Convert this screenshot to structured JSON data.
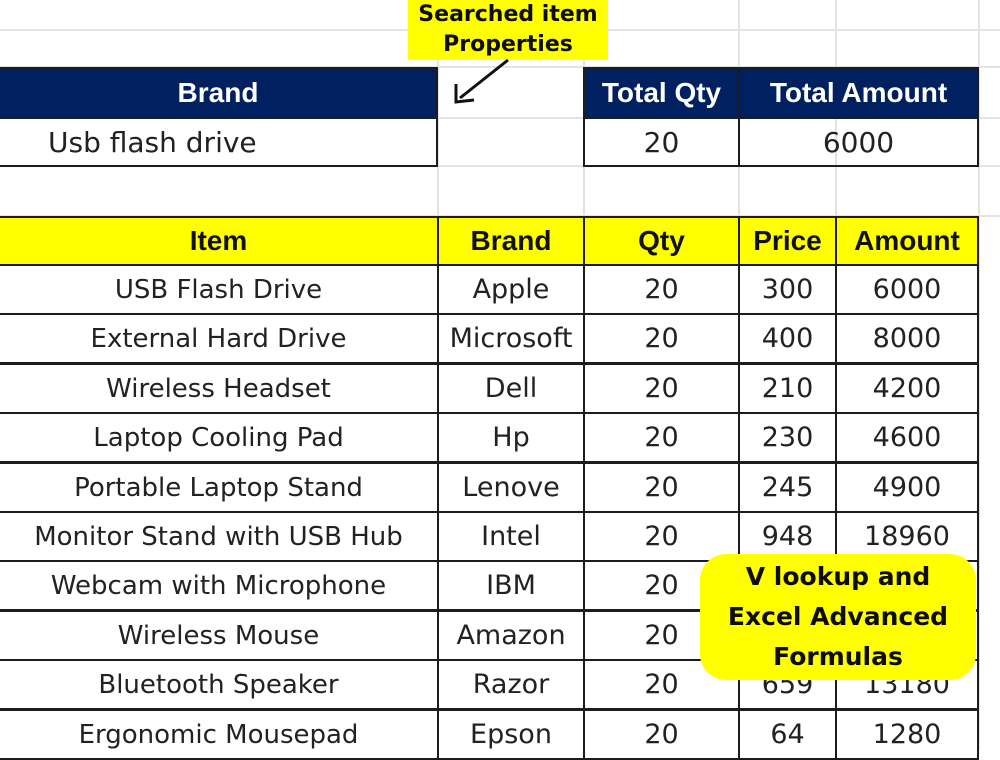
{
  "annotation_top": {
    "line1": "Searched item",
    "line2": "Properties"
  },
  "lookup": {
    "brand_header": "Brand",
    "brand_value": "Usb flash drive",
    "total_qty_header": "Total Qty",
    "total_qty_value": "20",
    "total_amount_header": "Total Amount",
    "total_amount_value": "6000"
  },
  "table": {
    "headers": {
      "item": "Item",
      "brand": "Brand",
      "qty": "Qty",
      "price": "Price",
      "amount": "Amount"
    },
    "rows": [
      {
        "item": "USB Flash Drive",
        "brand": "Apple",
        "qty": "20",
        "price": "300",
        "amount": "6000"
      },
      {
        "item": "External Hard Drive",
        "brand": "Microsoft",
        "qty": "20",
        "price": "400",
        "amount": "8000"
      },
      {
        "item": "Wireless Headset",
        "brand": "Dell",
        "qty": "20",
        "price": "210",
        "amount": "4200"
      },
      {
        "item": "Laptop Cooling Pad",
        "brand": "Hp",
        "qty": "20",
        "price": "230",
        "amount": "4600"
      },
      {
        "item": "Portable Laptop Stand",
        "brand": "Lenove",
        "qty": "20",
        "price": "245",
        "amount": "4900"
      },
      {
        "item": "Monitor Stand with USB Hub",
        "brand": "Intel",
        "qty": "20",
        "price": "948",
        "amount": "18960"
      },
      {
        "item": "Webcam with Microphone",
        "brand": "IBM",
        "qty": "20",
        "price": "",
        "amount": ""
      },
      {
        "item": "Wireless Mouse",
        "brand": "Amazon",
        "qty": "20",
        "price": "",
        "amount": ""
      },
      {
        "item": "Bluetooth Speaker",
        "brand": "Razor",
        "qty": "20",
        "price": "659",
        "amount": "13180"
      },
      {
        "item": "Ergonomic Mousepad",
        "brand": "Epson",
        "qty": "20",
        "price": "64",
        "amount": "1280"
      }
    ]
  },
  "badge": {
    "line1": "V lookup and",
    "line2": "Excel Advanced",
    "line3": "Formulas"
  },
  "colors": {
    "header_navy": "#00205f",
    "header_yellow": "#ffff00",
    "callout_yellow": "#ffff00"
  }
}
